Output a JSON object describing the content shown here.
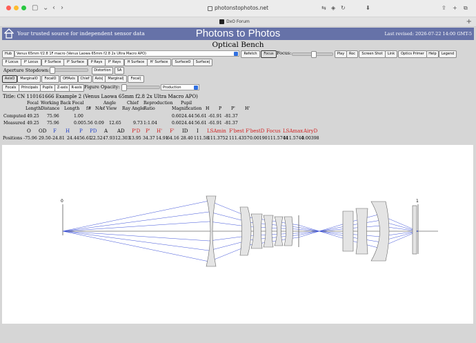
{
  "browser": {
    "url": "photonstophotos.net",
    "tab_title": "DxO Forum",
    "new_tab_glyph": "+",
    "icons": [
      "back-icon",
      "forward-icon",
      "sidebar-icon",
      "lock-icon",
      "translate-icon",
      "shield-icon",
      "reload-icon",
      "download-icon",
      "share-icon",
      "new-tab-icon",
      "tabs-overview-icon"
    ]
  },
  "header": {
    "tagline": "Your trusted source for independent sensor data",
    "site_title": "Photons to Photos",
    "revised": "Last revised: 2026-07-22 14:00 GMT-5",
    "page_title": "Optical Bench",
    "colors": {
      "banner": "#6672a8",
      "accent_red": "#d21e1e",
      "accent_blue": "#1e3ec8"
    }
  },
  "toolbar1": {
    "hub": "Hub",
    "lens_select": "Venus 65mm f/2.8 1F macro (Venus Laowa 65mm f2.8 2x Ultra Macro APO)",
    "refetch": "Refetch",
    "focus_btn": "Focus",
    "focus_label": "Focus:",
    "play": "Play",
    "roc": "Roc",
    "screenshot": "Screen Shot",
    "link": "Link",
    "optics_primer": "Optics Primer",
    "help": "Help",
    "legend": "Legend"
  },
  "toolbar2": [
    "P Locus",
    "P' Locus",
    "P Surface",
    "P' Surface",
    "P Rays",
    "P' Rays",
    "H Surface",
    "H' Surface",
    "SurfaceO",
    "Surface|"
  ],
  "toolbar3": {
    "aperture_label": "Aperture Stopdown:",
    "distortion": "Distortion",
    "sa": "SA"
  },
  "toolbar4": [
    "AxisO",
    "MarginalO",
    "FocalO",
    "OffAxis",
    "Chief",
    "Axis|",
    "Marginal|",
    "Focal|"
  ],
  "toolbar5": {
    "buttons": [
      "Focals",
      "Principals",
      "Pupils",
      "Z-axis",
      "R-axis"
    ],
    "opacity_label": "Figure Opacity:",
    "opacity_select": "Production"
  },
  "lens_title": "Title: CN 110161666 Example 2 (Venus Laowa 65mm f2.8 2x Ultra Macro APO)",
  "data_table": {
    "headers": {
      "row1": [
        "Focal",
        "Working Back Focal",
        "Angle",
        "Chief",
        "Reproduction",
        "Pupil"
      ],
      "row2": [
        "Length",
        "Distance",
        "Length",
        "f#",
        "NA",
        "of View",
        "Ray Angle",
        "Ratio",
        "Magnification",
        "H",
        "P",
        "P'",
        "H'"
      ]
    },
    "computed": {
      "label": "Computed",
      "values": [
        "49.25",
        "75.96",
        "1.00",
        "",
        "",
        "",
        "",
        "",
        "0.60",
        "24.44",
        "56.61",
        "-61.91",
        "-81.37"
      ]
    },
    "measured": {
      "label": "Measured",
      "values": [
        "49.25",
        "75.96",
        "0.00",
        "5.56",
        "0.09",
        "12.65",
        "",
        "9.73",
        "1:1.04",
        "0.60",
        "24.44",
        "56.61",
        "-61.91",
        "-81.37"
      ]
    }
  },
  "positions": {
    "labels": [
      {
        "text": "O",
        "color": "black"
      },
      {
        "text": "OD",
        "color": "black"
      },
      {
        "text": "F",
        "color": "blue"
      },
      {
        "text": "H",
        "color": "blue"
      },
      {
        "text": "P",
        "color": "blue"
      },
      {
        "text": "PD",
        "color": "blue"
      },
      {
        "text": "A",
        "color": "black"
      },
      {
        "text": "AD",
        "color": "black"
      },
      {
        "text": "P'D",
        "color": "red"
      },
      {
        "text": "P'",
        "color": "red"
      },
      {
        "text": "H'",
        "color": "red"
      },
      {
        "text": "F'",
        "color": "red"
      },
      {
        "text": "ID",
        "color": "black"
      },
      {
        "text": "I",
        "color": "black"
      },
      {
        "text": "LSAmin",
        "color": "red"
      },
      {
        "text": "F'best",
        "color": "red"
      },
      {
        "text": "F'bestD",
        "color": "red"
      },
      {
        "text": "Focus",
        "color": "red"
      },
      {
        "text": "LSAmax",
        "color": "red"
      },
      {
        "text": "AiryD",
        "color": "red"
      }
    ],
    "row_label": "Positions",
    "values": [
      "-75.96",
      "29.50",
      "-24.81",
      "24.44",
      "56.61",
      "22.52",
      "47.93",
      "12.303",
      "13.95",
      "34.37",
      "14.91",
      "64.16",
      "28.40",
      "111.58",
      "111.3752",
      "111.4357",
      "0.00190",
      "111.5744",
      "111.5744",
      "0.00398"
    ]
  },
  "diagram": {
    "object_label": "0",
    "image_label": "1",
    "ray_color": "#3a4fd8",
    "element_fill": "#e4e4e4"
  }
}
